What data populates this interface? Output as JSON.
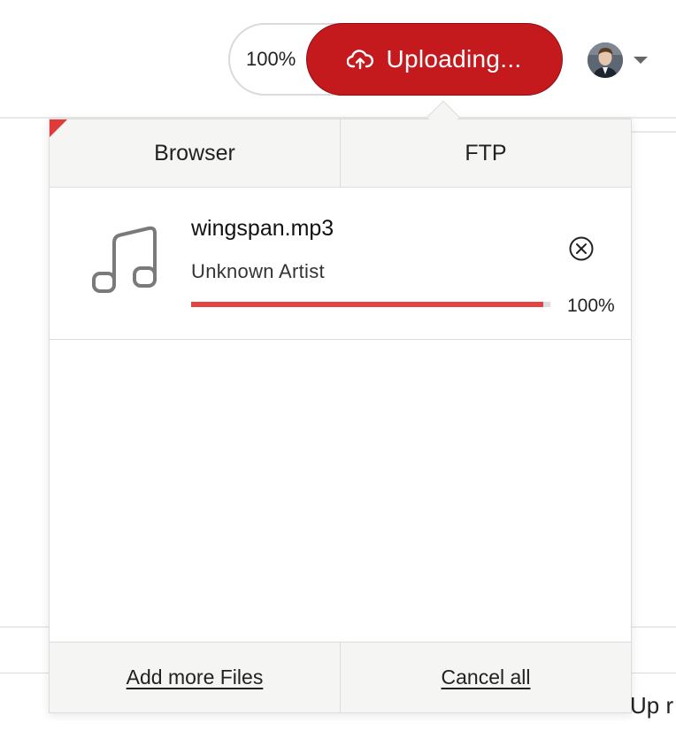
{
  "header": {
    "upload_percent": "100%",
    "upload_button_label": "Uploading...",
    "accent_color": "#c41a1e"
  },
  "panel": {
    "tabs": [
      {
        "label": "Browser"
      },
      {
        "label": "FTP"
      }
    ],
    "files": [
      {
        "name": "wingspan.mp3",
        "artist": "Unknown Artist",
        "progress": 0.98,
        "progress_label": "100%",
        "icon": "music-note-icon"
      }
    ],
    "footer": {
      "add_more_label": "Add more Files",
      "cancel_all_label": "Cancel all"
    }
  },
  "background": {
    "peek_text": "Up r"
  }
}
